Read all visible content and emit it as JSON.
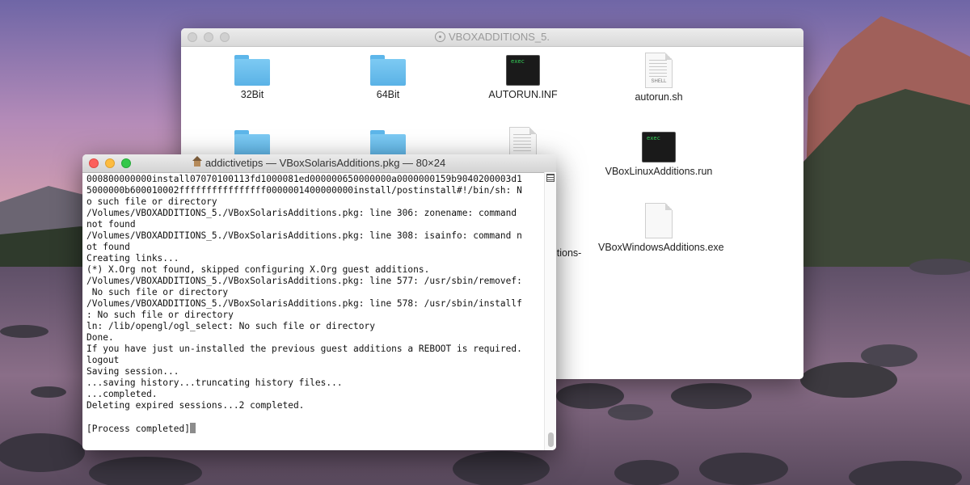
{
  "finder": {
    "title": "VBOXADDITIONS_5.",
    "items": [
      {
        "label": "32Bit",
        "icon": "folder-icon"
      },
      {
        "label": "64Bit",
        "icon": "folder-icon"
      },
      {
        "label": "AUTORUN.INF",
        "icon": "exec-icon"
      },
      {
        "label": "autorun.sh",
        "icon": "shell-doc-icon"
      },
      {
        "label": "VBoxLinuxAdditions.run",
        "icon": "exec-icon"
      },
      {
        "label": "VBoxWindowsAdditions.exe",
        "icon": "document-icon"
      },
      {
        "label": "itions-",
        "icon": "none"
      }
    ],
    "exec_tag": "exec",
    "shell_tag": "SHELL"
  },
  "terminal": {
    "title": "addictivetips — VBoxSolarisAdditions.pkg — 80×24",
    "lines": [
      "000800000000install07070100113fd1000081ed000000650000000a0000000159b9040200003d1",
      "5000000b600010002ffffffffffffffff0000001400000000install/postinstall#!/bin/sh: N",
      "o such file or directory",
      "/Volumes/VBOXADDITIONS_5./VBoxSolarisAdditions.pkg: line 306: zonename: command",
      "not found",
      "/Volumes/VBOXADDITIONS_5./VBoxSolarisAdditions.pkg: line 308: isainfo: command n",
      "ot found",
      "Creating links...",
      "(*) X.Org not found, skipped configuring X.Org guest additions.",
      "/Volumes/VBOXADDITIONS_5./VBoxSolarisAdditions.pkg: line 577: /usr/sbin/removef:",
      " No such file or directory",
      "/Volumes/VBOXADDITIONS_5./VBoxSolarisAdditions.pkg: line 578: /usr/sbin/installf",
      ": No such file or directory",
      "ln: /lib/opengl/ogl_select: No such file or directory",
      "Done.",
      "If you have just un-installed the previous guest additions a REBOOT is required.",
      "logout",
      "Saving session...",
      "...saving history...truncating history files...",
      "...completed.",
      "Deleting expired sessions...2 completed.",
      "",
      "[Process completed]"
    ]
  },
  "colors": {
    "close": "#fc605c",
    "minimize": "#fdbc40",
    "zoom": "#34c84a",
    "folder": "#5ab2e6"
  }
}
